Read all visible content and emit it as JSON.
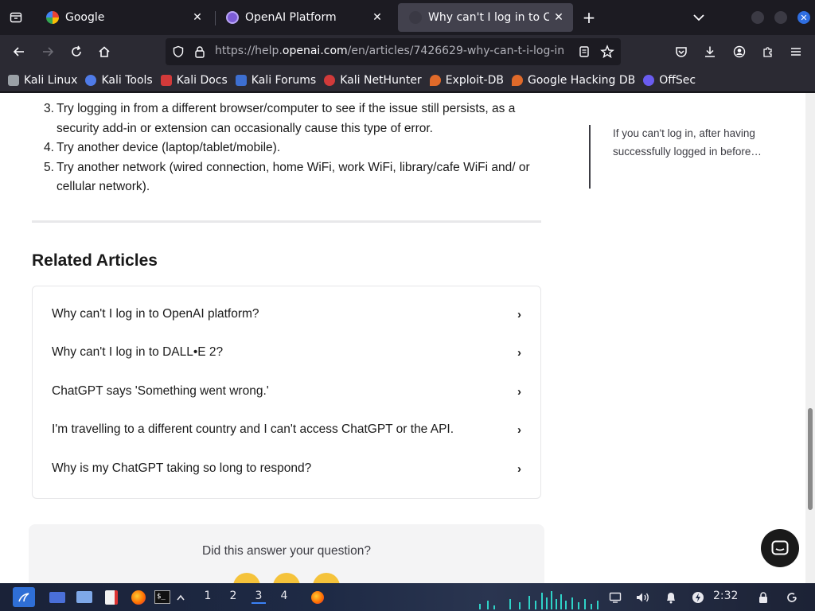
{
  "browser": {
    "tabs": [
      {
        "title": "Google",
        "favicon_color": "#4285f4"
      },
      {
        "title": "OpenAI Platform",
        "favicon_color": "#7c5cd6"
      },
      {
        "title": "Why can't I log in to Chat",
        "favicon_color": "#3a3944"
      }
    ],
    "url_prefix": "https://help.",
    "url_host": "openai.com",
    "url_path": "/en/articles/7426629-why-can-t-i-log-in"
  },
  "bookmarks": [
    {
      "label": "Kali Linux",
      "color": "#9aa0a6"
    },
    {
      "label": "Kali Tools",
      "color": "#4f7be8"
    },
    {
      "label": "Kali Docs",
      "color": "#d23a3a"
    },
    {
      "label": "Kali Forums",
      "color": "#3d6fd1"
    },
    {
      "label": "Kali NetHunter",
      "color": "#d13a3a"
    },
    {
      "label": "Exploit-DB",
      "color": "#e06a2a"
    },
    {
      "label": "Google Hacking DB",
      "color": "#e06a2a"
    },
    {
      "label": "OffSec",
      "color": "#6a5cf0"
    }
  ],
  "article": {
    "steps": [
      {
        "num": "3.",
        "text": "Try logging in from a different browser/computer to see if the issue still persists, as a security add-in or extension can occasionally cause this type of error."
      },
      {
        "num": "4.",
        "text": "Try another device (laptop/tablet/mobile)."
      },
      {
        "num": "5.",
        "text": "Try another network (wired connection, home WiFi, work WiFi, library/cafe WiFi and/ or cellular network)."
      }
    ],
    "related_title": "Related Articles",
    "related": [
      "Why can't I log in to OpenAI platform?",
      "Why can't I log in to DALL•E 2?",
      "ChatGPT says 'Something went wrong.'",
      "I'm travelling to a different country and I can't access ChatGPT or the API.",
      "Why is my ChatGPT taking so long to respond?"
    ],
    "feedback_question": "Did this answer your question?"
  },
  "sidebar": {
    "summary": "If you can't log in, after having successfully logged in before…"
  },
  "taskbar": {
    "workspaces": [
      "1",
      "2",
      "3",
      "4"
    ],
    "active_workspace": "3",
    "clock": "2:32"
  }
}
